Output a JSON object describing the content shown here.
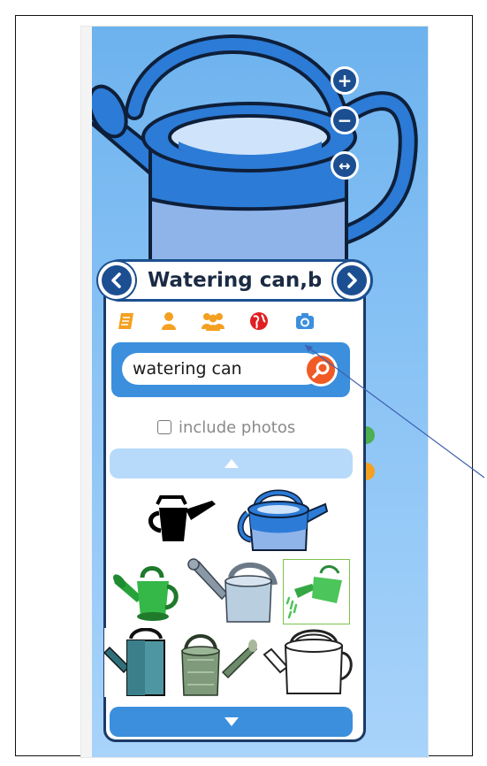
{
  "card": {
    "title": "Watering can,b",
    "prev_label": "previous symbol",
    "next_label": "next symbol"
  },
  "search": {
    "value": "watering can"
  },
  "options": {
    "include_photos_label": "include photos",
    "include_photos_checked": false
  },
  "icons": {
    "zoom_in": "plus-icon",
    "zoom_out": "minus-icon",
    "fit_width": "double-arrow-icon",
    "tabs": [
      "book-icon",
      "person-icon",
      "group-icon",
      "globe-icon",
      "camera-icon"
    ],
    "search": "magnifier-icon"
  },
  "results": [
    {
      "name": "black watering can"
    },
    {
      "name": "blue watering can"
    },
    {
      "name": "green watering can"
    },
    {
      "name": "grey watering can"
    },
    {
      "name": "green watering can pouring"
    },
    {
      "name": "teal watering can"
    },
    {
      "name": "metal watering can"
    },
    {
      "name": "outline watering can"
    }
  ],
  "colors": {
    "background_blue": "#7bbaf0",
    "header_navy": "#1c4f92",
    "accent_orange": "#f4a020",
    "search_orange": "#f15a24",
    "scroll_light": "#b7dafb",
    "scroll_dark": "#3b8fdd"
  }
}
